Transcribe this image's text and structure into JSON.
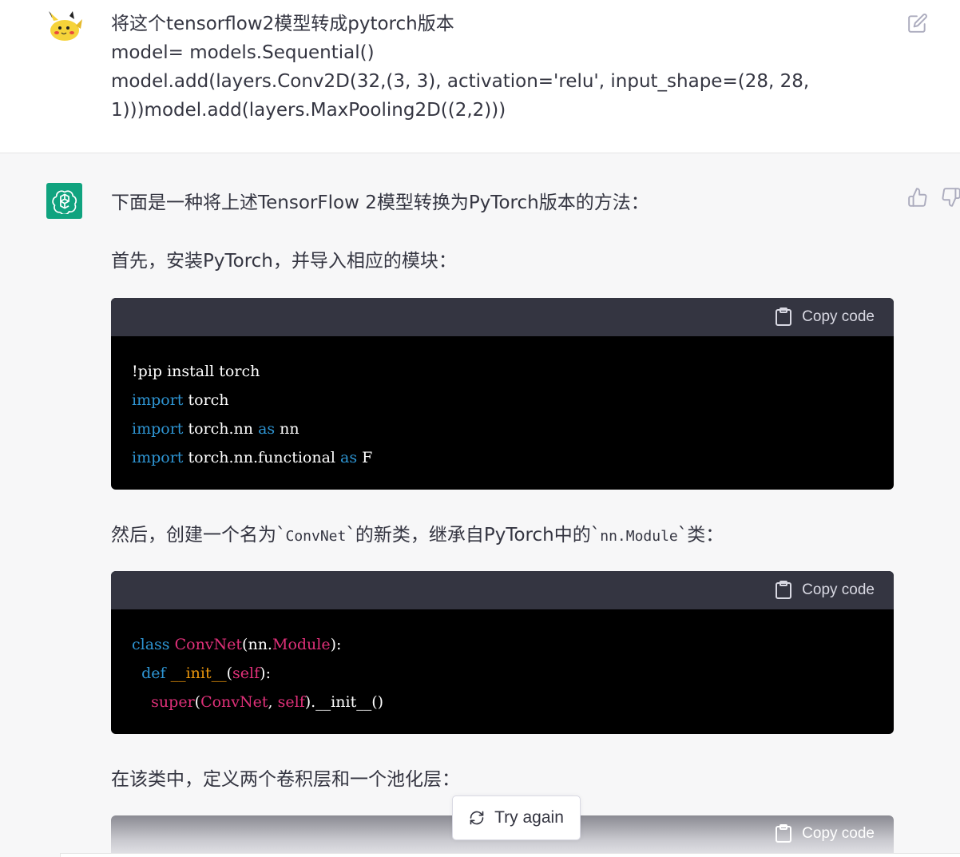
{
  "user_message": {
    "text": "将这个tensorflow2模型转成pytorch版本\nmodel= models.Sequential()\nmodel.add(layers.Conv2D(32,(3, 3), activation='relu', input_shape=(28, 28, 1)))model.add(layers.MaxPooling2D((2,2)))",
    "avatar_icon": "pikachu-avatar-icon",
    "edit_icon": "edit-icon"
  },
  "assistant": {
    "avatar_icon": "openai-logo-icon",
    "avatar_color": "#10a37f",
    "para1": "下面是一种将上述TensorFlow 2模型转换为PyTorch版本的方法：",
    "para2": "首先，安装PyTorch，并导入相应的模块：",
    "para3_before": "然后，创建一个名为`",
    "para3_code1": "ConvNet",
    "para3_mid": "`的新类，继承自PyTorch中的`",
    "para3_code2": "nn.Module",
    "para3_after": "`类：",
    "para4": "在该类中，定义两个卷积层和一个池化层："
  },
  "code_blocks": [
    {
      "copy_label": "Copy code",
      "lines": [
        [
          {
            "t": "!pip install torch",
            "c": ""
          }
        ],
        [
          {
            "t": "import",
            "c": "kw"
          },
          {
            "t": " torch",
            "c": ""
          }
        ],
        [
          {
            "t": "import",
            "c": "kw"
          },
          {
            "t": " torch.nn ",
            "c": ""
          },
          {
            "t": "as",
            "c": "kw"
          },
          {
            "t": " nn",
            "c": ""
          }
        ],
        [
          {
            "t": "import",
            "c": "kw"
          },
          {
            "t": " torch.nn.functional ",
            "c": ""
          },
          {
            "t": "as",
            "c": "kw"
          },
          {
            "t": " F",
            "c": ""
          }
        ]
      ]
    },
    {
      "copy_label": "Copy code",
      "lines": [
        [
          {
            "t": "class",
            "c": "kw"
          },
          {
            "t": " ",
            "c": ""
          },
          {
            "t": "ConvNet",
            "c": "cls"
          },
          {
            "t": "(nn.",
            "c": ""
          },
          {
            "t": "Module",
            "c": "cls"
          },
          {
            "t": "):",
            "c": ""
          }
        ],
        [
          {
            "t": "  ",
            "c": ""
          },
          {
            "t": "def",
            "c": "kw"
          },
          {
            "t": " ",
            "c": ""
          },
          {
            "t": "__init__",
            "c": "fn"
          },
          {
            "t": "(",
            "c": ""
          },
          {
            "t": "self",
            "c": "pm"
          },
          {
            "t": "):",
            "c": ""
          }
        ],
        [
          {
            "t": "    ",
            "c": ""
          },
          {
            "t": "super",
            "c": "pm"
          },
          {
            "t": "(",
            "c": ""
          },
          {
            "t": "ConvNet",
            "c": "cls"
          },
          {
            "t": ", ",
            "c": ""
          },
          {
            "t": "self",
            "c": "pm"
          },
          {
            "t": ").__init__()",
            "c": ""
          }
        ]
      ]
    },
    {
      "copy_label": "Copy code"
    }
  ],
  "try_again_label": "Try again",
  "colors": {
    "code_header": "#343541",
    "keyword": "#2e95d3",
    "class_name": "#df3079",
    "function_name": "#e9950c"
  }
}
